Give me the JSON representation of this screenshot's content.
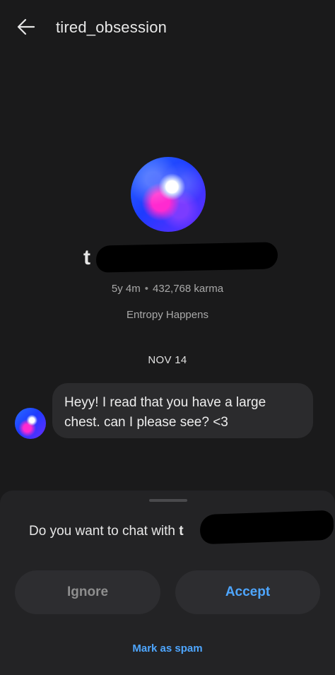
{
  "header": {
    "title": "tired_obsession",
    "back_icon": "back-arrow-icon"
  },
  "profile": {
    "username_visible_initial": "t",
    "account_age": "5y 4m",
    "separator": "•",
    "karma": "432,768 karma",
    "bio": "Entropy Happens"
  },
  "chat": {
    "date_label": "NOV 14",
    "message_text": "Heyy! I read that you have a large chest. can I please see? <3"
  },
  "request_sheet": {
    "prompt_prefix": "Do you want to chat with ",
    "prompt_visible_initial": "t",
    "ignore_label": "Ignore",
    "accept_label": "Accept",
    "spam_label": "Mark as spam"
  },
  "colors": {
    "background": "#1a1a1b",
    "bubble": "#2b2b2d",
    "sheet": "#232325",
    "accent": "#4ea6ff"
  }
}
